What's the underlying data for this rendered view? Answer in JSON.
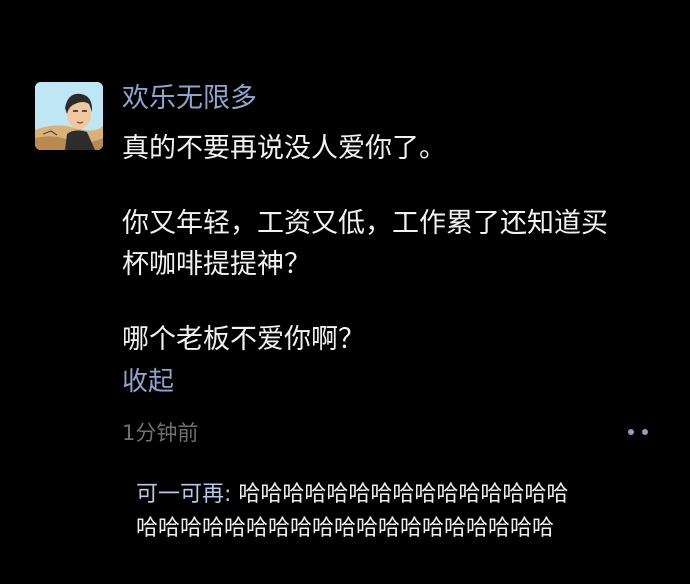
{
  "comment": {
    "author": "欢乐无限多",
    "lines": [
      "真的不要再说没人爱你了。",
      "你又年轻，工资又低，工作累了还知道买",
      "杯咖啡提提神？",
      "哪个老板不爱你啊？"
    ],
    "collapse_label": "收起",
    "time": "1分钟前",
    "more_icon": "more-dots-icon"
  },
  "reply": {
    "author": "可一可再:",
    "text_line1": "哈哈哈哈哈哈哈哈哈哈哈哈哈哈哈",
    "text_line2": "哈哈哈哈哈哈哈哈哈哈哈哈哈哈哈哈哈哈哈"
  },
  "colors": {
    "background": "#000000",
    "link": "#8fa4cc",
    "text": "#f2f2f2",
    "muted": "#6f6f6f"
  }
}
